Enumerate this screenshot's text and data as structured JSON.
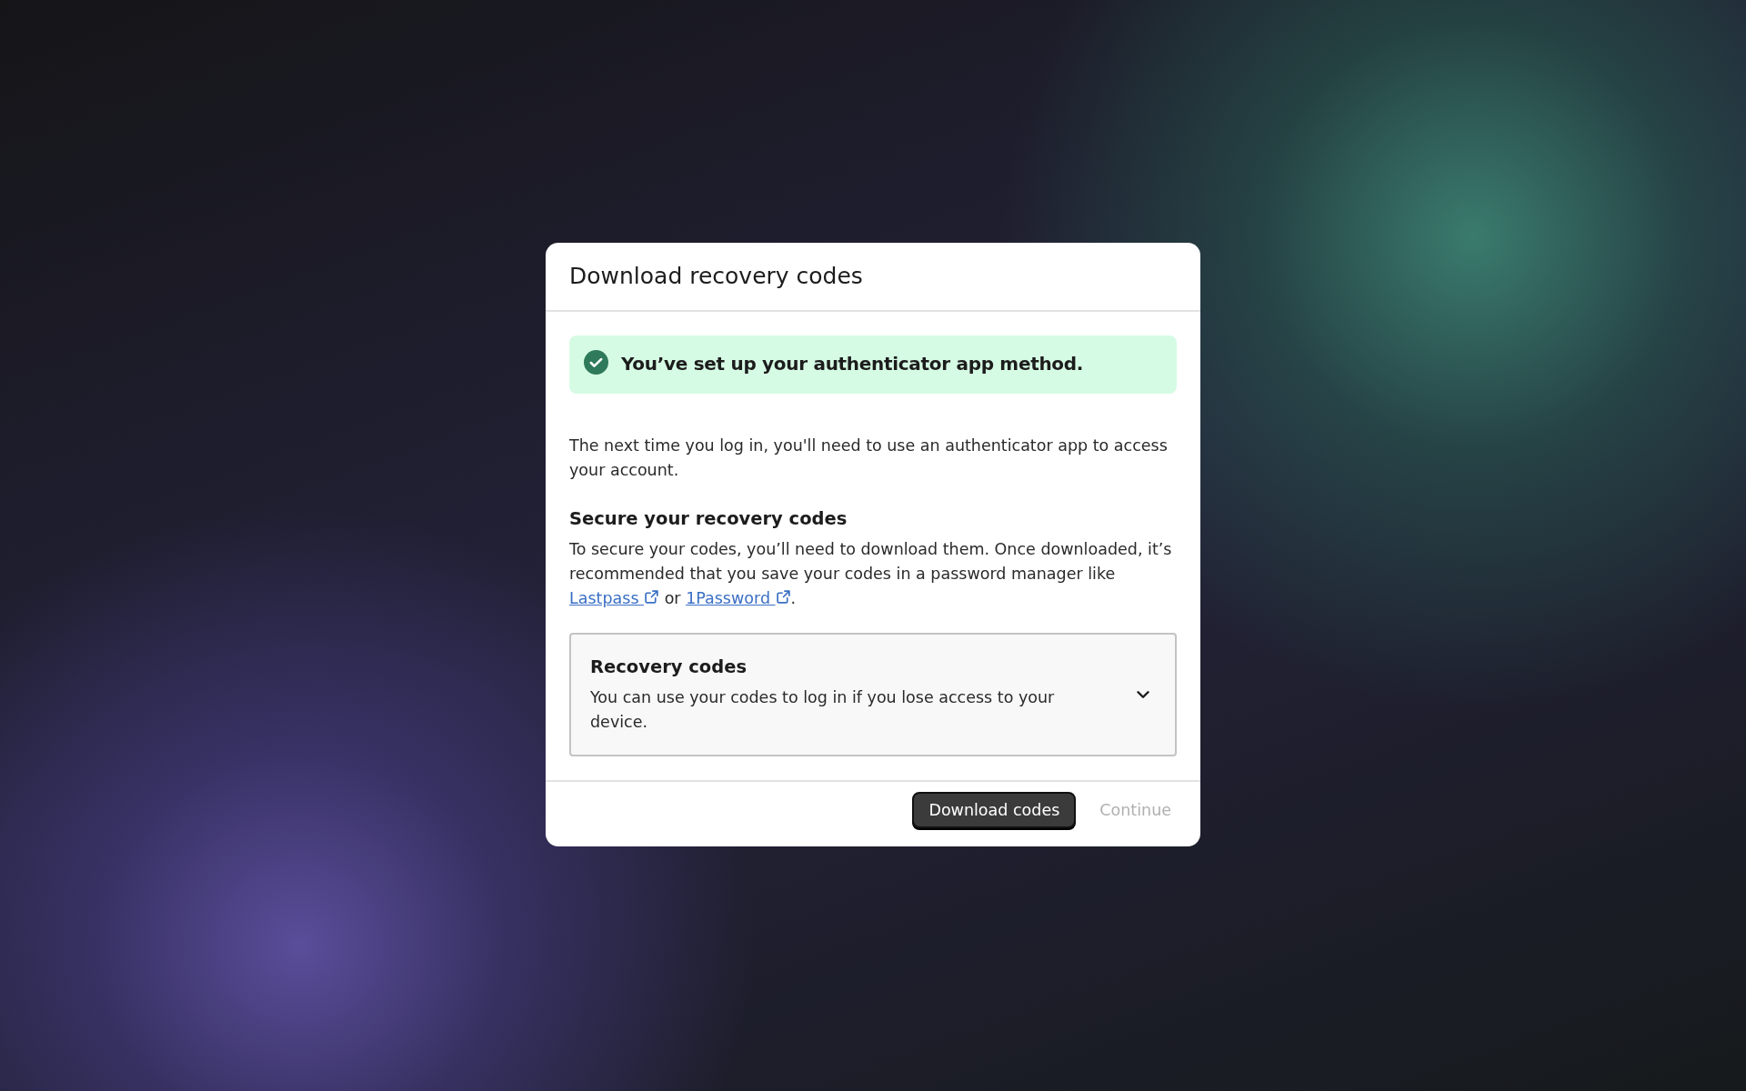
{
  "dialog": {
    "title": "Download recovery codes",
    "banner": {
      "kind": "success",
      "text": "You’ve set up your authenticator app method."
    },
    "intro": "The next time you log in, you'll need to use an authenticator app to access your account.",
    "section": {
      "heading": "Secure your recovery codes",
      "parts": [
        {
          "kind": "text",
          "text": "To secure your codes, you’ll need to download them. Once downloaded, it’s recommended that you save your codes in a password manager like "
        },
        {
          "kind": "link",
          "text": "Lastpass"
        },
        {
          "kind": "text",
          "text": " or "
        },
        {
          "kind": "link",
          "text": "1Password"
        },
        {
          "kind": "text",
          "text": "."
        }
      ]
    },
    "accordion": {
      "title": "Recovery codes",
      "description": "You can use your codes to log in if you lose access to your device.",
      "expanded": false
    },
    "buttons": [
      {
        "label": "Download codes",
        "kind": "primary",
        "disabled": false
      },
      {
        "label": "Continue",
        "kind": "plain",
        "disabled": true
      }
    ]
  }
}
